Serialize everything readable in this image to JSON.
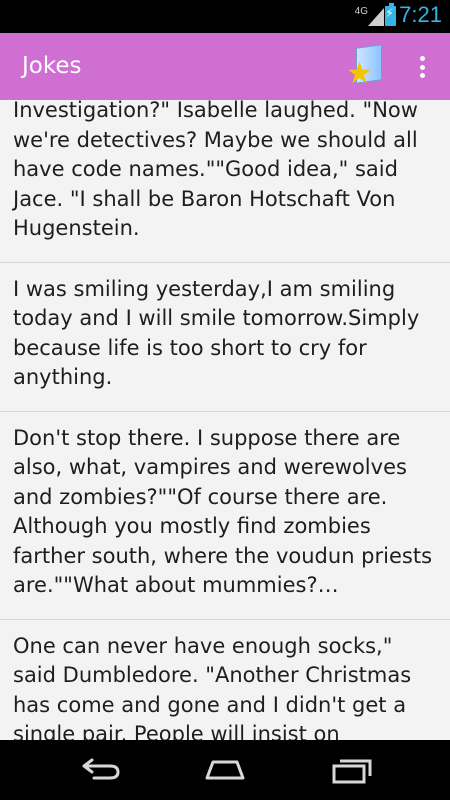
{
  "status_bar": {
    "network": "4G",
    "time": "7:21"
  },
  "action_bar": {
    "title": "Jokes"
  },
  "jokes": [
    {
      "text": "Investigation?\" Isabelle laughed. \"Now we're detectives? Maybe we should all have code names.\"\"Good idea,\" said Jace. \"I shall be Baron Hotschaft Von Hugenstein."
    },
    {
      "text": "I was smiling yesterday,I am smiling today and I will smile tomorrow.Simply because life is too short to cry for anything."
    },
    {
      "text": "Don't stop there. I suppose there are also, what, vampires and werewolves and zombies?\"\"Of course there are. Although you mostly find zombies farther south, where the voudun priests are.\"\"What about mummies?…"
    },
    {
      "text": "One can never have enough socks,\" said Dumbledore. \"Another Christmas has come and gone and I didn't get a single pair. People will insist on"
    }
  ],
  "icons": {
    "favorites": "favorites-star-icon",
    "overflow": "overflow-menu-icon",
    "back": "back-icon",
    "home": "home-icon",
    "recent": "recent-apps-icon"
  },
  "colors": {
    "action_bar": "#cf6fd2",
    "status_accent": "#33b5e5",
    "list_background": "#f3f3f3"
  }
}
